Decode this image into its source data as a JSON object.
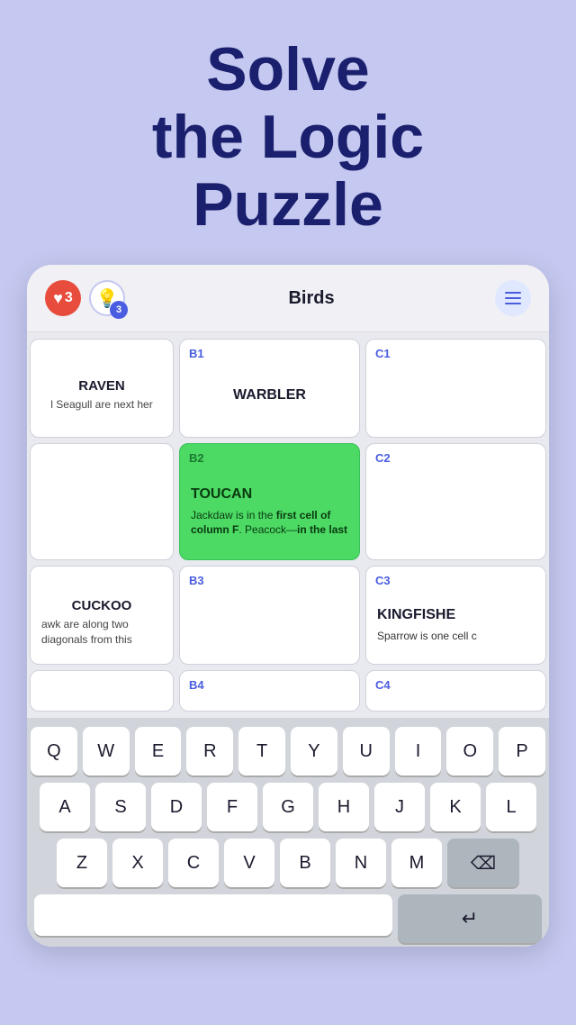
{
  "hero": {
    "title_line1": "Solve",
    "title_line2": "the Logic Puzzle"
  },
  "app_header": {
    "lives": "3",
    "hints": "3",
    "title": "Birds",
    "menu_icon": "≡"
  },
  "grid": {
    "rows": [
      {
        "id": "row1",
        "left_cell": {
          "name": "RAVEN",
          "clue": "l Seagull are next her"
        },
        "cells": [
          {
            "id": "B1",
            "bird": "WARBLER",
            "clue": ""
          },
          {
            "id": "C1",
            "bird": "",
            "clue": ""
          }
        ]
      },
      {
        "id": "row2",
        "left_cell": {
          "name": "",
          "clue": ""
        },
        "cells": [
          {
            "id": "B2",
            "bird": "TOUCAN",
            "clue": "Jackdaw is in the first cell of column F. Peacock—in the last",
            "highlighted": true
          },
          {
            "id": "C2",
            "bird": "",
            "clue": ""
          }
        ]
      },
      {
        "id": "row3",
        "left_cell": {
          "name": "CUCKOO",
          "clue": "awk are along two diagonals from this"
        },
        "cells": [
          {
            "id": "B3",
            "bird": "",
            "clue": ""
          },
          {
            "id": "C3",
            "bird": "KINGFISHE",
            "clue": "Sparrow is one cell c"
          }
        ]
      },
      {
        "id": "row4",
        "left_cell": {
          "name": "",
          "clue": ""
        },
        "cells": [
          {
            "id": "B4",
            "bird": "",
            "clue": ""
          },
          {
            "id": "C4",
            "bird": "",
            "clue": ""
          }
        ]
      }
    ]
  },
  "keyboard": {
    "rows": [
      [
        "Q",
        "W",
        "E",
        "R",
        "T",
        "Y",
        "U",
        "I",
        "O",
        "P"
      ],
      [
        "A",
        "S",
        "D",
        "F",
        "G",
        "H",
        "J",
        "K",
        "L"
      ],
      [
        "Z",
        "X",
        "C",
        "V",
        "B",
        "N",
        "M"
      ]
    ],
    "backspace": "⌫",
    "return": "↵"
  }
}
